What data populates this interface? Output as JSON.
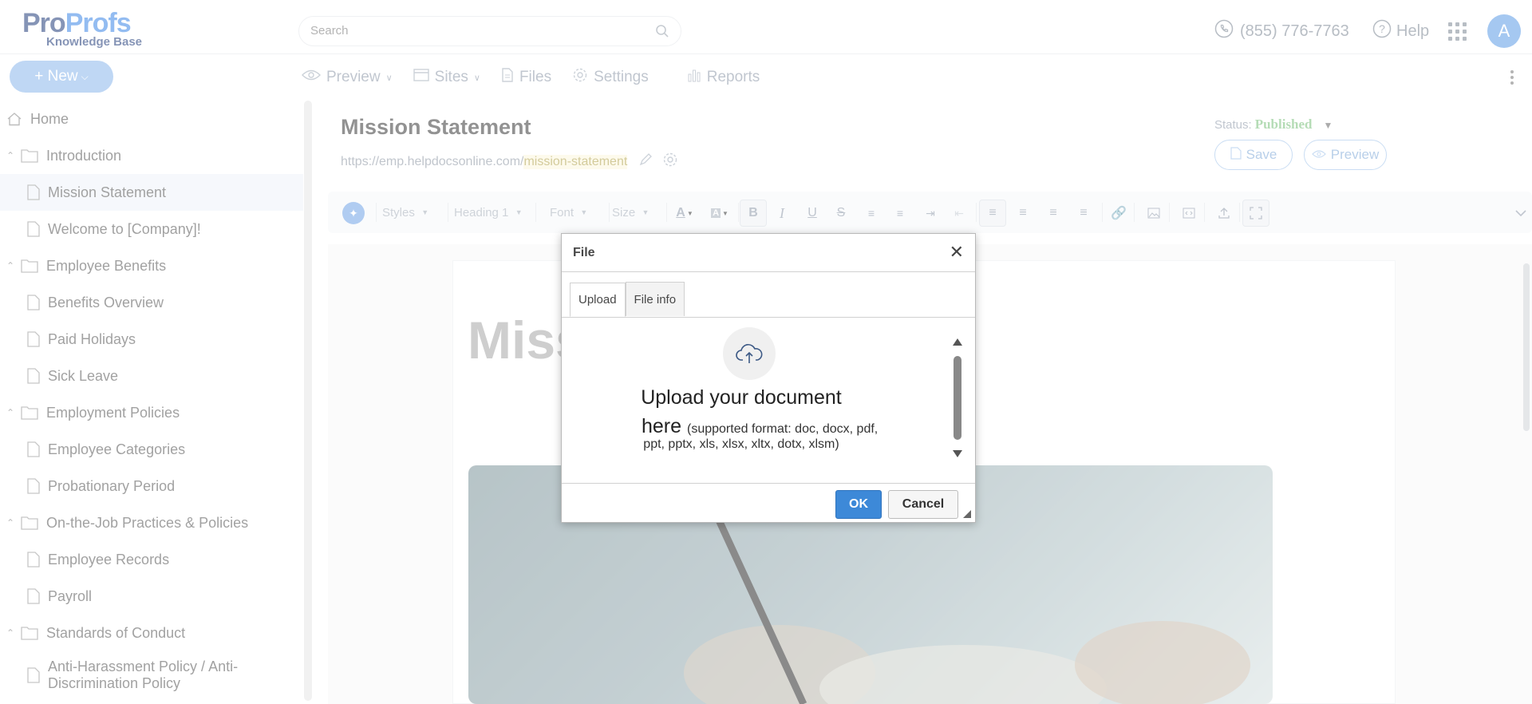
{
  "header": {
    "logo_part1": "Pro",
    "logo_part2": "Profs",
    "logo_sub": "Knowledge Base",
    "search_placeholder": "Search",
    "phone": "(855) 776-7763",
    "help": "Help",
    "avatar_letter": "A"
  },
  "nav": {
    "new_label": "+ New",
    "items": [
      "Preview",
      "Sites",
      "Files",
      "Settings",
      "Reports"
    ]
  },
  "sidebar": {
    "items": [
      {
        "label": "Home",
        "kind": "home"
      },
      {
        "label": "Introduction",
        "kind": "folder"
      },
      {
        "label": "Mission Statement",
        "kind": "page",
        "active": true
      },
      {
        "label": "Welcome to [Company]!",
        "kind": "page"
      },
      {
        "label": "Employee Benefits",
        "kind": "folder"
      },
      {
        "label": "Benefits Overview",
        "kind": "page"
      },
      {
        "label": "Paid Holidays",
        "kind": "page"
      },
      {
        "label": "Sick Leave",
        "kind": "page"
      },
      {
        "label": "Employment Policies",
        "kind": "folder"
      },
      {
        "label": "Employee Categories",
        "kind": "page"
      },
      {
        "label": "Probationary Period",
        "kind": "page"
      },
      {
        "label": "On-the-Job Practices & Policies",
        "kind": "folder"
      },
      {
        "label": "Employee Records",
        "kind": "page"
      },
      {
        "label": "Payroll",
        "kind": "page"
      },
      {
        "label": "Standards of Conduct",
        "kind": "folder"
      },
      {
        "label": "Anti-Harassment Policy / Anti-Discrimination Policy",
        "kind": "page"
      }
    ]
  },
  "document": {
    "title": "Mission Statement",
    "url_base": "https://emp.helpdocsonline.com/",
    "url_slug": "mission-statement",
    "status_label": "Status:",
    "status_value": "Published",
    "save_label": "Save",
    "preview_label": "Preview",
    "big_title": "Miss"
  },
  "toolbar": {
    "styles": "Styles",
    "heading": "Heading 1",
    "font": "Font",
    "size": "Size"
  },
  "dialog": {
    "title": "File",
    "tabs": [
      "Upload",
      "File info"
    ],
    "upload_line1": "Upload your document",
    "upload_line2": "here",
    "upload_fmt_a": "(supported format: doc, docx, pdf,",
    "upload_fmt_b": "ppt, pptx, xls, xlsx, xltx, dotx, xlsm)",
    "ok_label": "OK",
    "cancel_label": "Cancel"
  },
  "colors": {
    "brand_dark": "#223c7a",
    "brand_light": "#3b86e6",
    "published": "#79c07a",
    "ok_button": "#3d89d8"
  }
}
